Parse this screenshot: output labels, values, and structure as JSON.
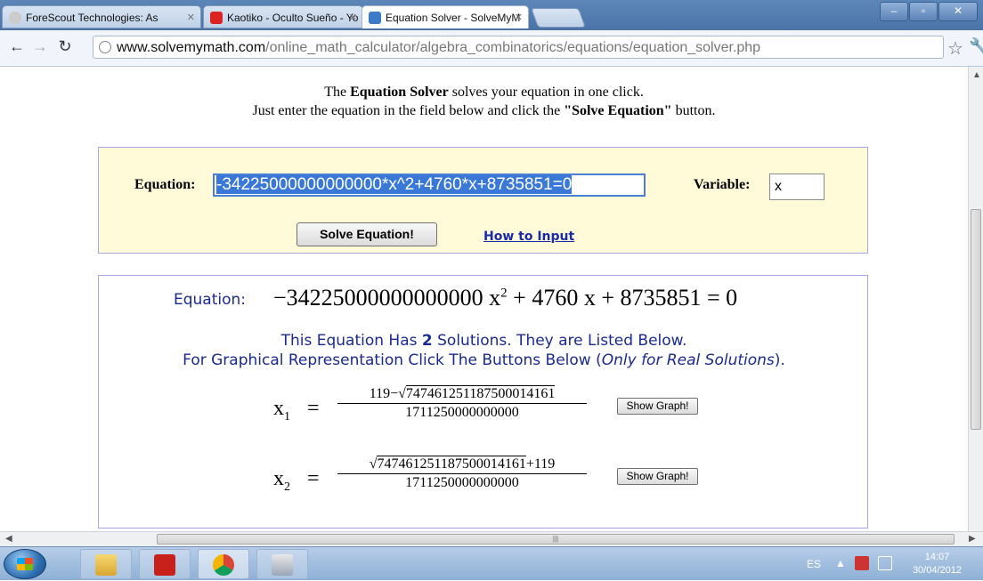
{
  "browser": {
    "tabs": [
      {
        "label": "ForeScout Technologies: As",
        "active": false
      },
      {
        "label": "Kaotiko - Oculto Sueño - Yo",
        "active": false
      },
      {
        "label": "Equation Solver - SolveMyM",
        "active": true
      }
    ],
    "url_domain": "www.solvemymath.com",
    "url_path": "/online_math_calculator/algebra_combinatorics/equations/equation_solver.php"
  },
  "intro": {
    "line1_pre": "The ",
    "line1_bold": "Equation Solver",
    "line1_post": " solves your equation in one click.",
    "line2_pre": "Just enter the equation in the field below and click the ",
    "line2_bold": "\"Solve Equation\"",
    "line2_post": " button."
  },
  "form": {
    "equation_label": "Equation:",
    "equation_value": "-34225000000000000*x^2+4760*x+8735851=0",
    "variable_label": "Variable:",
    "variable_value": "x",
    "solve_button": "Solve Equation!",
    "how_link": "How to Input"
  },
  "result": {
    "equation_label": "Equation:",
    "equation_lhs": "−34225000000000000 x",
    "equation_exp": "2",
    "equation_rest": " + 4760 x + 8735851 = 0",
    "line1_pre": "This Equation Has ",
    "solution_count": "2",
    "line1_post": " Solutions. They are Listed Below.",
    "line2_pre": "For Graphical Representation Click The Buttons Below (",
    "line2_em": "Only for Real Solutions",
    "line2_post": ").",
    "solutions": [
      {
        "name": "x",
        "sub": "1",
        "num_pre": "119−√",
        "num_rad": "747461251187500014161",
        "num_post": "",
        "den": "1711250000000000",
        "button": "Show Graph!"
      },
      {
        "name": "x",
        "sub": "2",
        "num_pre": "√",
        "num_rad": "747461251187500014161",
        "num_post": "+119",
        "den": "1711250000000000",
        "button": "Show Graph!"
      }
    ]
  },
  "taskbar": {
    "language": "ES",
    "time": "14:07",
    "date": "30/04/2012"
  },
  "colors": {
    "form_bg": "#fffbd9",
    "box_border": "#a6a6e8",
    "blue_text": "#1a2a8e",
    "selection": "#3a78d8"
  }
}
